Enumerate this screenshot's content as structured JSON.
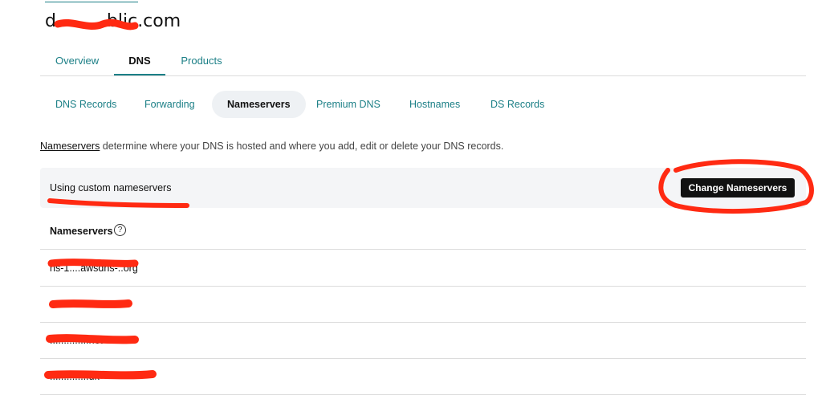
{
  "header": {
    "back_arrow": "<",
    "domain": "d.........blic.com"
  },
  "main_tabs": [
    {
      "label": "Overview"
    },
    {
      "label": "DNS"
    },
    {
      "label": "Products"
    }
  ],
  "sub_tabs": [
    {
      "label": "DNS Records"
    },
    {
      "label": "Forwarding"
    },
    {
      "label": "Nameservers"
    },
    {
      "label": "Premium DNS"
    },
    {
      "label": "Hostnames"
    },
    {
      "label": "DS Records"
    }
  ],
  "description": {
    "link": "Nameservers",
    "text": " determine where your DNS is hosted and where you add, edit or delete your DNS records."
  },
  "status": {
    "text": "Using custom nameservers",
    "button": "Change Nameservers"
  },
  "nameservers": {
    "header": "Nameservers",
    "help": "?",
    "rows": [
      {
        "value": "ns-1....awsdns-..org"
      },
      {
        "value": "..............com"
      },
      {
        "value": "..............net"
      },
      {
        "value": "..............uk"
      }
    ]
  },
  "colors": {
    "accent": "#1b7f86",
    "button": "#111111",
    "annotation": "#ff2a12"
  }
}
